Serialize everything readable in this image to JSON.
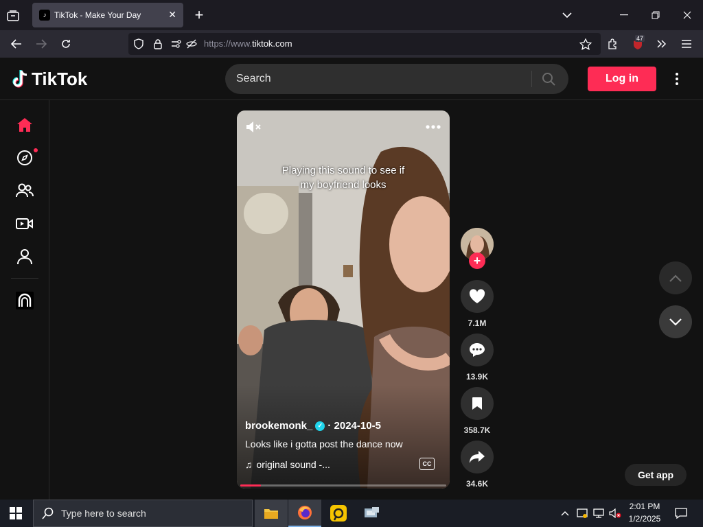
{
  "browser": {
    "tab_title": "TikTok - Make Your Day",
    "url_prefix": "https://www.",
    "url_domain": "tiktok.com",
    "extension_badge": "47"
  },
  "header": {
    "logo_text": "TikTok",
    "search_placeholder": "Search",
    "login_label": "Log in"
  },
  "video": {
    "caption_line1": "Playing this sound to see if",
    "caption_line2": "my boyfriend looks",
    "author": "brookemonk_",
    "date": "· 2024-10-5",
    "description": "Looks like i gotta post the dance now",
    "sound": "original sound -..."
  },
  "actions": {
    "likes": "7.1M",
    "comments": "13.9K",
    "saves": "358.7K",
    "shares": "34.6K"
  },
  "get_app_label": "Get app",
  "taskbar": {
    "search_placeholder": "Type here to search",
    "time": "2:01 PM",
    "date": "1/2/2025"
  },
  "colors": {
    "brand": "#fe2c55",
    "verified": "#20d5ec"
  }
}
